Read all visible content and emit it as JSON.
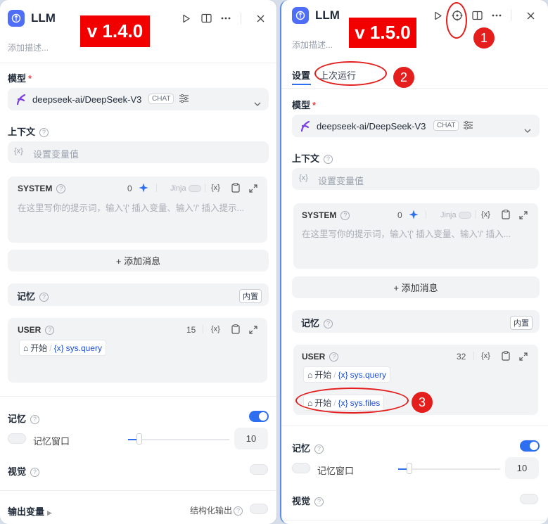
{
  "panel_a": {
    "title": "LLM",
    "version": "v 1.4.0",
    "description": "添加描述...",
    "model_label": "模型",
    "model_name": "deepseek-ai/DeepSeek-V3",
    "model_tag": "CHAT",
    "context_label": "上下文",
    "context_placeholder": "设置变量值",
    "var_glyph": "{x}",
    "system_title": "SYSTEM",
    "system_count": "0",
    "jinja_label": "Jinja",
    "system_placeholder": "在这里写你的提示词，输入'{' 插入变量、输入'/' 插入提示...",
    "add_message": "+ 添加消息",
    "memory_label": "记忆",
    "builtin_tag": "内置",
    "user_title": "USER",
    "user_count": "15",
    "chip_source": "开始",
    "chip_var": "sys.query",
    "memory2_label": "记忆",
    "memory_window_label": "记忆窗口",
    "memory_window_value": "10",
    "vision_label": "视觉",
    "output_label": "输出变量",
    "structured_label": "结构化输出"
  },
  "panel_b": {
    "title": "LLM",
    "version": "v 1.5.0",
    "description": "添加描述...",
    "tab_settings": "设置",
    "tab_last_run": "上次运行",
    "model_label": "模型",
    "model_name": "deepseek-ai/DeepSeek-V3",
    "model_tag": "CHAT",
    "context_label": "上下文",
    "context_placeholder": "设置变量值",
    "var_glyph": "{x}",
    "system_title": "SYSTEM",
    "system_count": "0",
    "jinja_label": "Jinja",
    "system_placeholder": "在这里写你的提示词，输入'{' 插入变量、输入'/' 插入...",
    "add_message": "+ 添加消息",
    "memory_label": "记忆",
    "builtin_tag": "内置",
    "user_title": "USER",
    "user_count": "32",
    "chip1_source": "开始",
    "chip1_var": "sys.query",
    "chip2_source": "开始",
    "chip2_var": "sys.files",
    "memory2_label": "记忆",
    "memory_window_label": "记忆窗口",
    "memory_window_value": "10",
    "vision_label": "视觉"
  },
  "callouts": [
    "1",
    "2",
    "3"
  ],
  "colors": {
    "accent": "#2d6ff0",
    "badge": "#f20000",
    "callout": "#e41d1d",
    "node_icon": "#4f6ef7"
  }
}
